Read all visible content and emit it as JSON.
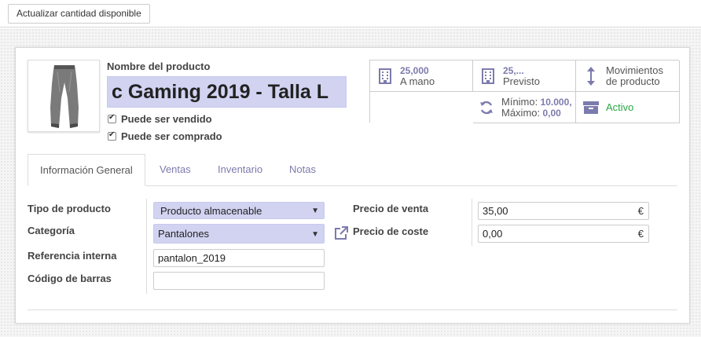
{
  "topbar": {
    "update_button": "Actualizar cantidad disponible"
  },
  "product": {
    "name_label": "Nombre del producto",
    "name_value": "c Gaming 2019 - Talla L",
    "can_be_sold": "Puede ser vendido",
    "can_be_purchased": "Puede ser comprado"
  },
  "stats": {
    "on_hand": {
      "value": "25,000",
      "label": "A mano",
      "icon": "building-icon"
    },
    "forecast": {
      "value": "25,...",
      "label": "Previsto",
      "icon": "building-icon"
    },
    "moves": {
      "line1": "Movimientos",
      "line2": "de producto",
      "icon": "arrows-vertical-icon"
    },
    "reorder": {
      "min_label": "Mínimo:",
      "min_value": "10.000,",
      "max_label": "Máximo:",
      "max_value": "0,00",
      "icon": "refresh-icon"
    },
    "active": {
      "label": "Activo",
      "icon": "archive-icon"
    }
  },
  "tabs": [
    "Información General",
    "Ventas",
    "Inventario",
    "Notas"
  ],
  "general": {
    "product_type_label": "Tipo de producto",
    "product_type_value": "Producto almacenable",
    "category_label": "Categoría",
    "category_value": "Pantalones",
    "internal_ref_label": "Referencia interna",
    "internal_ref_value": "pantalon_2019",
    "barcode_label": "Código de barras",
    "barcode_value": "",
    "sale_price_label": "Precio de venta",
    "sale_price_value": "35,00",
    "cost_label": "Precio de coste",
    "cost_value": "0,00",
    "currency": "€"
  },
  "colors": {
    "accent": "#7c7bad",
    "required_bg": "#d1d3f1",
    "active_green": "#28a745"
  }
}
